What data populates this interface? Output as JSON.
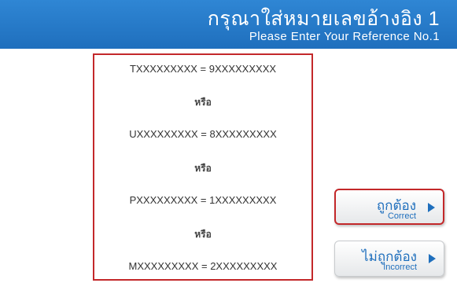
{
  "header": {
    "title_thai": "กรุณาใส่หมายเลขอ้างอิง 1",
    "title_english": "Please Enter Your Reference No.1"
  },
  "reference_formats": [
    "TXXXXXXXXX = 9XXXXXXXXX",
    "UXXXXXXXXX = 8XXXXXXXXX",
    "PXXXXXXXXX = 1XXXXXXXXX",
    "MXXXXXXXXX = 2XXXXXXXXX"
  ],
  "or_label": "หรือ",
  "buttons": {
    "correct_thai": "ถูกต้อง",
    "correct_english": "Correct",
    "incorrect_thai": "ไม่ถูกต้อง",
    "incorrect_english": "Incorrect",
    "arrow_icon": "play-arrow-icon"
  },
  "colors": {
    "header_blue": "#1f6fbd",
    "highlight_red": "#c3282a",
    "button_text_blue": "#1f6fbd"
  }
}
